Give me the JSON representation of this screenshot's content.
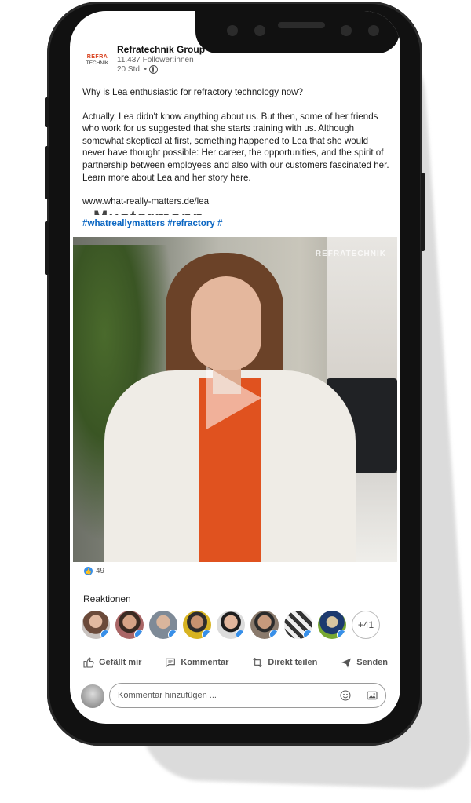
{
  "post": {
    "company": "Refratechnik Group",
    "followers": "11.437 Follower:innen",
    "time": "20 Std. •",
    "logo_top": "REFRA",
    "logo_bottom": "TECHNIK",
    "menu_icon": "more-horizontal-icon",
    "text": {
      "p1": "Why is Lea enthusiastic for refractory technology now?",
      "p2": "Actually, Lea didn't know anything about us. But then, some of her friends who work for us suggested that she starts training with us. Although somewhat skeptical at first, something happened to Lea that she would never have thought possible: Her career, the opportunities, and the spirit of partnership between employees and also with our customers fascinated her. Learn more about Lea and her story here.",
      "p3": "www.what-really-matters.de/lea",
      "ghost": "Mustermann"
    },
    "hashtags": "#whatreallymatters #refractory #",
    "video_brand": "REFRATECHNIK"
  },
  "reactions": {
    "count": "49",
    "title": "Reaktionen",
    "more": "+41"
  },
  "actions": {
    "like": "Gefällt mir",
    "comment": "Kommentar",
    "share": "Direkt teilen",
    "send": "Senden"
  },
  "comment": {
    "placeholder": "Kommentar hinzufügen ..."
  },
  "colors": {
    "link": "#0a66c2",
    "like_blue": "#378fe9",
    "logo_red": "#d8401c"
  }
}
